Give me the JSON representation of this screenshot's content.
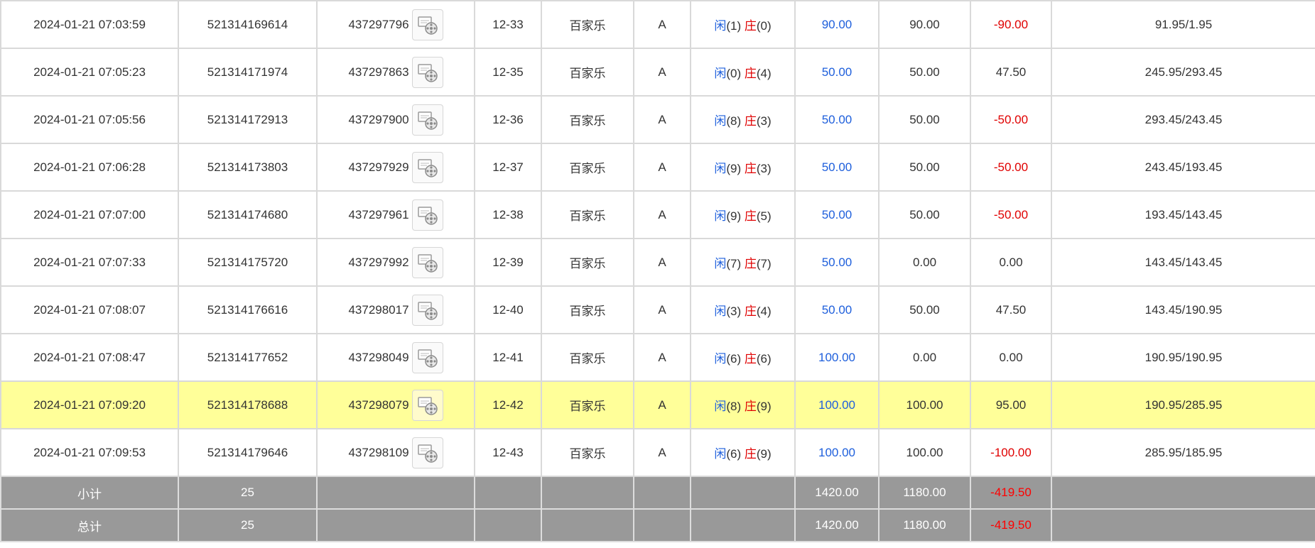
{
  "theme": {
    "highlight_color": "#ffff99",
    "negative_color": "#e00000",
    "player_color": "#1e5fdc",
    "summary_bg": "#999999"
  },
  "rows": [
    {
      "time": "2024-01-21 07:03:59",
      "bet_id": "521314169614",
      "game_id": "437297796",
      "round": "12-33",
      "game": "百家乐",
      "table": "A",
      "player_label": "闲",
      "player_score": "(1)",
      "banker_label": "庄",
      "banker_score": "(0)",
      "bet": "90.00",
      "valid": "90.00",
      "win_loss": "-90.00",
      "balance": "91.95/1.95",
      "negative": true,
      "highlight": false
    },
    {
      "time": "2024-01-21 07:05:23",
      "bet_id": "521314171974",
      "game_id": "437297863",
      "round": "12-35",
      "game": "百家乐",
      "table": "A",
      "player_label": "闲",
      "player_score": "(0)",
      "banker_label": "庄",
      "banker_score": "(4)",
      "bet": "50.00",
      "valid": "50.00",
      "win_loss": "47.50",
      "balance": "245.95/293.45",
      "negative": false,
      "highlight": false
    },
    {
      "time": "2024-01-21 07:05:56",
      "bet_id": "521314172913",
      "game_id": "437297900",
      "round": "12-36",
      "game": "百家乐",
      "table": "A",
      "player_label": "闲",
      "player_score": "(8)",
      "banker_label": "庄",
      "banker_score": "(3)",
      "bet": "50.00",
      "valid": "50.00",
      "win_loss": "-50.00",
      "balance": "293.45/243.45",
      "negative": true,
      "highlight": false
    },
    {
      "time": "2024-01-21 07:06:28",
      "bet_id": "521314173803",
      "game_id": "437297929",
      "round": "12-37",
      "game": "百家乐",
      "table": "A",
      "player_label": "闲",
      "player_score": "(9)",
      "banker_label": "庄",
      "banker_score": "(3)",
      "bet": "50.00",
      "valid": "50.00",
      "win_loss": "-50.00",
      "balance": "243.45/193.45",
      "negative": true,
      "highlight": false
    },
    {
      "time": "2024-01-21 07:07:00",
      "bet_id": "521314174680",
      "game_id": "437297961",
      "round": "12-38",
      "game": "百家乐",
      "table": "A",
      "player_label": "闲",
      "player_score": "(9)",
      "banker_label": "庄",
      "banker_score": "(5)",
      "bet": "50.00",
      "valid": "50.00",
      "win_loss": "-50.00",
      "balance": "193.45/143.45",
      "negative": true,
      "highlight": false
    },
    {
      "time": "2024-01-21 07:07:33",
      "bet_id": "521314175720",
      "game_id": "437297992",
      "round": "12-39",
      "game": "百家乐",
      "table": "A",
      "player_label": "闲",
      "player_score": "(7)",
      "banker_label": "庄",
      "banker_score": "(7)",
      "bet": "50.00",
      "valid": "0.00",
      "win_loss": "0.00",
      "balance": "143.45/143.45",
      "negative": false,
      "highlight": false
    },
    {
      "time": "2024-01-21 07:08:07",
      "bet_id": "521314176616",
      "game_id": "437298017",
      "round": "12-40",
      "game": "百家乐",
      "table": "A",
      "player_label": "闲",
      "player_score": "(3)",
      "banker_label": "庄",
      "banker_score": "(4)",
      "bet": "50.00",
      "valid": "50.00",
      "win_loss": "47.50",
      "balance": "143.45/190.95",
      "negative": false,
      "highlight": false
    },
    {
      "time": "2024-01-21 07:08:47",
      "bet_id": "521314177652",
      "game_id": "437298049",
      "round": "12-41",
      "game": "百家乐",
      "table": "A",
      "player_label": "闲",
      "player_score": "(6)",
      "banker_label": "庄",
      "banker_score": "(6)",
      "bet": "100.00",
      "valid": "0.00",
      "win_loss": "0.00",
      "balance": "190.95/190.95",
      "negative": false,
      "highlight": false
    },
    {
      "time": "2024-01-21 07:09:20",
      "bet_id": "521314178688",
      "game_id": "437298079",
      "round": "12-42",
      "game": "百家乐",
      "table": "A",
      "player_label": "闲",
      "player_score": "(8)",
      "banker_label": "庄",
      "banker_score": "(9)",
      "bet": "100.00",
      "valid": "100.00",
      "win_loss": "95.00",
      "balance": "190.95/285.95",
      "negative": false,
      "highlight": true
    },
    {
      "time": "2024-01-21 07:09:53",
      "bet_id": "521314179646",
      "game_id": "437298109",
      "round": "12-43",
      "game": "百家乐",
      "table": "A",
      "player_label": "闲",
      "player_score": "(6)",
      "banker_label": "庄",
      "banker_score": "(9)",
      "bet": "100.00",
      "valid": "100.00",
      "win_loss": "-100.00",
      "balance": "285.95/185.95",
      "negative": true,
      "highlight": false
    }
  ],
  "subtotal": {
    "label": "小计",
    "count": "25",
    "bet": "1420.00",
    "valid": "1180.00",
    "win_loss": "-419.50"
  },
  "total": {
    "label": "总计",
    "count": "25",
    "bet": "1420.00",
    "valid": "1180.00",
    "win_loss": "-419.50"
  }
}
